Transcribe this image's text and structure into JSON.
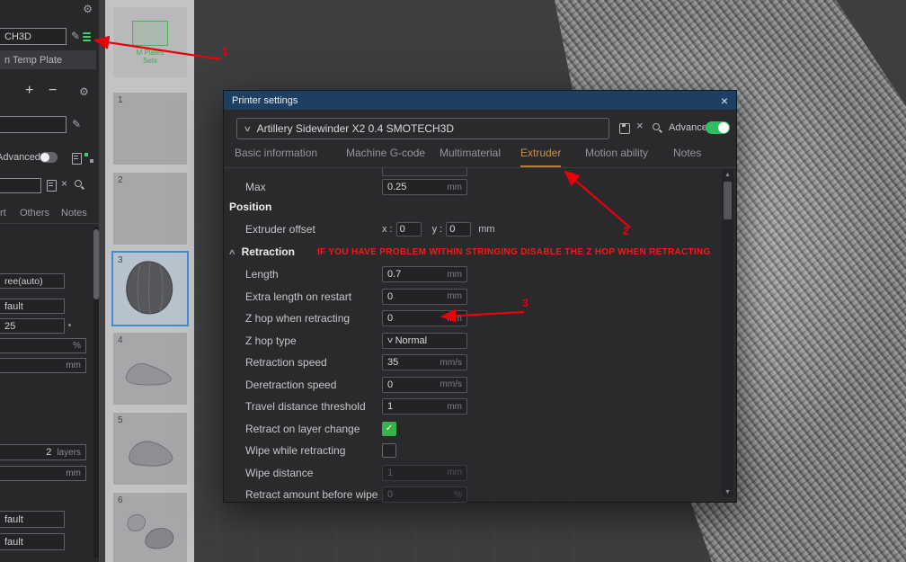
{
  "icons": {
    "gear": "⚙",
    "edit": "✎",
    "close": "×",
    "clear": "×",
    "plus": "+",
    "minus": "−",
    "caret_down": "∨",
    "collapse": "∧",
    "scroll_up": "▲",
    "scroll_down": "▼",
    "check": "✓"
  },
  "annotations": {
    "n1": "1",
    "n2": "2",
    "n3": "3"
  },
  "left_panel": {
    "printer_value": "CH3D",
    "plate_value": "n Temp Plate",
    "advanced_label": "Advanced",
    "tabs": [
      "rt",
      "Others",
      "Notes"
    ],
    "params": {
      "support_style": "ree(auto)",
      "default_1": "fault",
      "value_25": "25",
      "unit_percent": "%",
      "unit_mm": "mm",
      "layers_value": "2",
      "layers_unit": "layers",
      "unit_mm_2": "mm",
      "default_2": "fault",
      "default_3": "fault"
    }
  },
  "plate_strip": {
    "overview_label_line1": "M Plates",
    "overview_label_line2": "Sets",
    "numbers": [
      "1",
      "2",
      "3",
      "4",
      "5",
      "6"
    ]
  },
  "dialog": {
    "title": "Printer settings",
    "preset": "Artillery Sidewinder X2 0.4 SMOTECH3D",
    "advanced_label": "Advanced",
    "tabs": [
      "Basic information",
      "Machine G-code",
      "Multimaterial",
      "Extruder",
      "Motion ability",
      "Notes"
    ],
    "active_tab": "Extruder",
    "max_row": {
      "label": "Max",
      "value": "0.25",
      "unit": "mm"
    },
    "position_section": {
      "title": "Position",
      "offset_label": "Extruder offset",
      "x_label": "x :",
      "x_value": "0",
      "y_label": "y :",
      "y_value": "0",
      "unit": "mm"
    },
    "retraction_section": {
      "title": "Retraction",
      "warning": "IF YOU HAVE PROBLEM WITHIN STRINGING DISABLE THE Z HOP WHEN RETRACTING",
      "rows": [
        {
          "label": "Length",
          "value": "0.7",
          "unit": "mm",
          "type": "input"
        },
        {
          "label": "Extra length on restart",
          "value": "0",
          "unit": "mm",
          "type": "input"
        },
        {
          "label": "Z hop when retracting",
          "value": "0",
          "unit": "mm",
          "type": "input"
        },
        {
          "label": "Z hop type",
          "value": "Normal",
          "type": "select"
        },
        {
          "label": "Retraction speed",
          "value": "35",
          "unit": "mm/s",
          "type": "input"
        },
        {
          "label": "Deretraction speed",
          "value": "0",
          "unit": "mm/s",
          "type": "input"
        },
        {
          "label": "Travel distance threshold",
          "value": "1",
          "unit": "mm",
          "type": "input"
        },
        {
          "label": "Retract on layer change",
          "type": "checkbox",
          "checked": true
        },
        {
          "label": "Wipe while retracting",
          "type": "checkbox",
          "checked": false
        },
        {
          "label": "Wipe distance",
          "value": "1",
          "unit": "mm",
          "type": "input",
          "disabled": true
        },
        {
          "label": "Retract amount before wipe",
          "value": "0",
          "unit": "%",
          "type": "input",
          "disabled": true
        }
      ]
    }
  }
}
